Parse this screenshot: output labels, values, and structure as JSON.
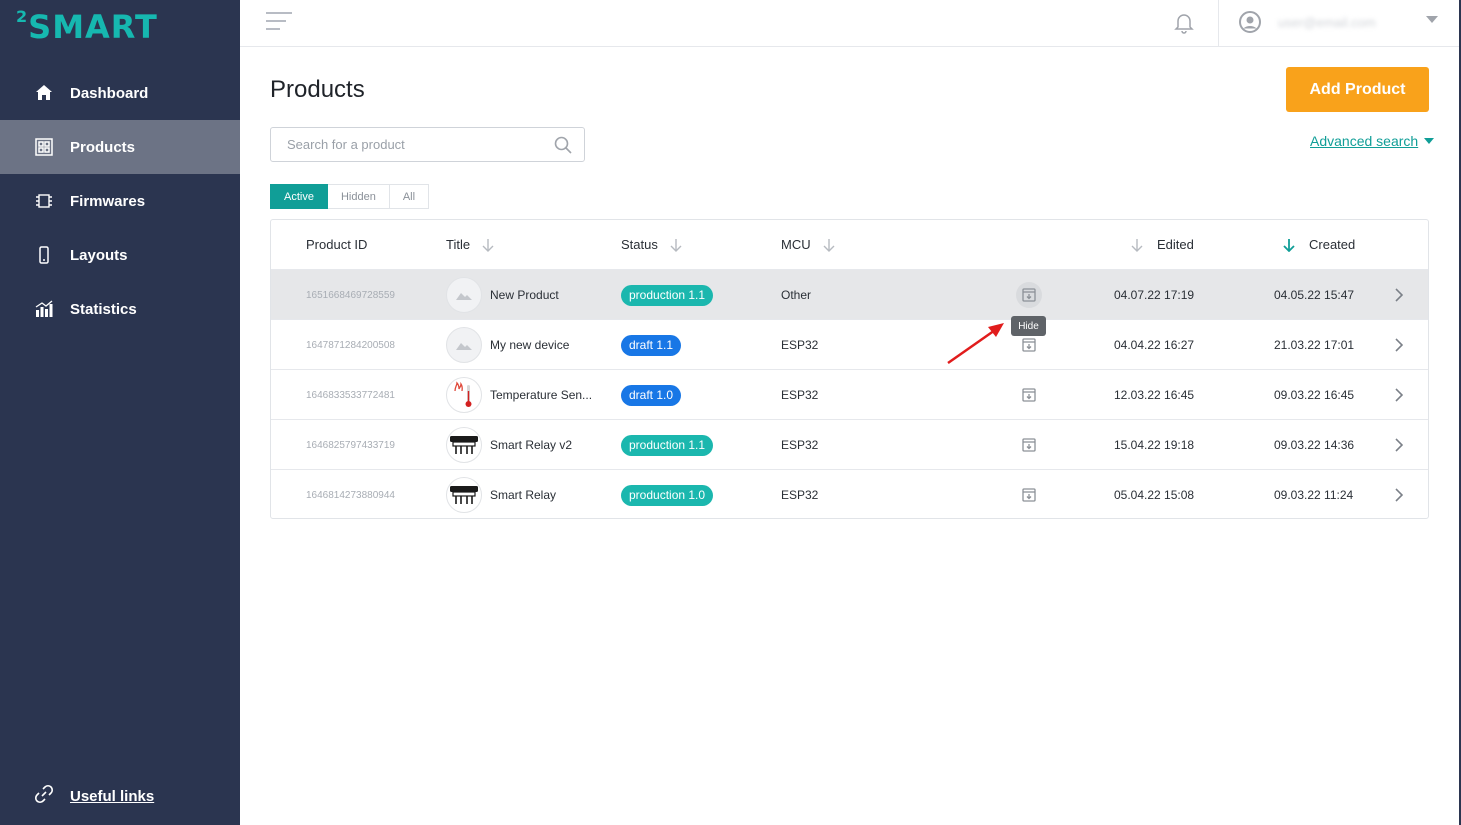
{
  "logo": {
    "sup": "2",
    "text": "SMART"
  },
  "sidebar": {
    "items": [
      {
        "label": "Dashboard",
        "icon": "home-icon"
      },
      {
        "label": "Products",
        "icon": "products-icon",
        "active": true
      },
      {
        "label": "Firmwares",
        "icon": "chip-icon"
      },
      {
        "label": "Layouts",
        "icon": "phone-icon"
      },
      {
        "label": "Statistics",
        "icon": "chart-icon"
      }
    ],
    "useful_links": "Useful links"
  },
  "topbar": {
    "user_email": "user@email.com"
  },
  "page": {
    "title": "Products",
    "add_button": "Add Product"
  },
  "search": {
    "placeholder": "Search for a product",
    "advanced": "Advanced search"
  },
  "tabs": [
    "Active",
    "Hidden",
    "All"
  ],
  "table": {
    "headers": {
      "id": "Product ID",
      "title": "Title",
      "status": "Status",
      "mcu": "MCU",
      "edited": "Edited",
      "created": "Created"
    },
    "rows": [
      {
        "id": "1651668469728559",
        "title": "New Product",
        "status": "production 1.1",
        "status_type": "production",
        "mcu": "Other",
        "edited": "04.07.22 17:19",
        "created": "04.05.22 15:47"
      },
      {
        "id": "1647871284200508",
        "title": "My new device",
        "status": "draft 1.1",
        "status_type": "draft",
        "mcu": "ESP32",
        "edited": "04.04.22 16:27",
        "created": "21.03.22 17:01"
      },
      {
        "id": "1646833533772481",
        "title": "Temperature Sen...",
        "status": "draft 1.0",
        "status_type": "draft",
        "mcu": "ESP32",
        "edited": "12.03.22 16:45",
        "created": "09.03.22 16:45"
      },
      {
        "id": "1646825797433719",
        "title": "Smart Relay v2",
        "status": "production 1.1",
        "status_type": "production",
        "mcu": "ESP32",
        "edited": "15.04.22 19:18",
        "created": "09.03.22 14:36"
      },
      {
        "id": "1646814273880944",
        "title": "Smart Relay",
        "status": "production 1.0",
        "status_type": "production",
        "mcu": "ESP32",
        "edited": "05.04.22 15:08",
        "created": "09.03.22 11:24"
      }
    ]
  },
  "tooltip": "Hide",
  "colors": {
    "sidebar": "#2b3550",
    "accent": "#109e97",
    "add_button": "#f9a21b",
    "production": "#1bb7ae",
    "draft": "#1877e6"
  }
}
